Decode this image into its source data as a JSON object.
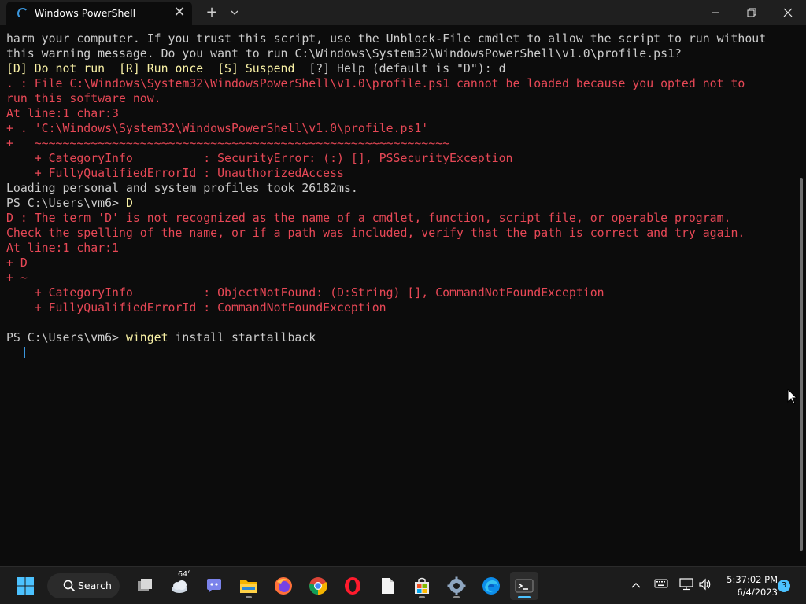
{
  "window": {
    "tab_title": "Windows PowerShell",
    "tab_close": "✕",
    "new_tab": "+",
    "tab_dropdown": "⌄",
    "minimize": "—",
    "maximize": "❐",
    "close": "✕"
  },
  "terminal": {
    "lines": [
      "harm your computer. If you trust this script, use the Unblock-File cmdlet to allow the script to run without",
      "this warning message. Do you want to run C:\\Windows\\System32\\WindowsPowerShell\\v1.0\\profile.ps1?",
      "[D] Do not run  [R] Run once  [S] Suspend  ",
      "[?] Help (default is \"D\"): d",
      ". : File C:\\Windows\\System32\\WindowsPowerShell\\v1.0\\profile.ps1 cannot be loaded because you opted not to",
      "run this software now.",
      "At line:1 char:3",
      "+ . 'C:\\Windows\\System32\\WindowsPowerShell\\v1.0\\profile.ps1'",
      "+   ~~~~~~~~~~~~~~~~~~~~~~~~~~~~~~~~~~~~~~~~~~~~~~~~~~~~~~~~~~~",
      "    + CategoryInfo          : SecurityError: (:) [], PSSecurityException",
      "    + FullyQualifiedErrorId : UnauthorizedAccess",
      "Loading personal and system profiles took 26182ms.",
      "PS C:\\Users\\vm6> ",
      "D",
      "D : The term 'D' is not recognized as the name of a cmdlet, function, script file, or operable program.",
      "Check the spelling of the name, or if a path was included, verify that the path is correct and try again.",
      "At line:1 char:1",
      "+ D",
      "+ ~",
      "    + CategoryInfo          : ObjectNotFound: (D:String) [], CommandNotFoundException",
      "    + FullyQualifiedErrorId : CommandNotFoundException",
      "PS C:\\Users\\vm6> ",
      "winget",
      " install startallback"
    ]
  },
  "taskbar": {
    "search_label": "Search",
    "weather_temp": "64°",
    "time": "5:37:02 PM",
    "date": "6/4/2023",
    "notification_count": "3"
  },
  "colors": {
    "terminal_bg": "#0c0c0c",
    "text": "#cccccc",
    "error": "#e74856",
    "prompt_highlight": "#f9f1a5",
    "accent": "#4cc2ff"
  }
}
